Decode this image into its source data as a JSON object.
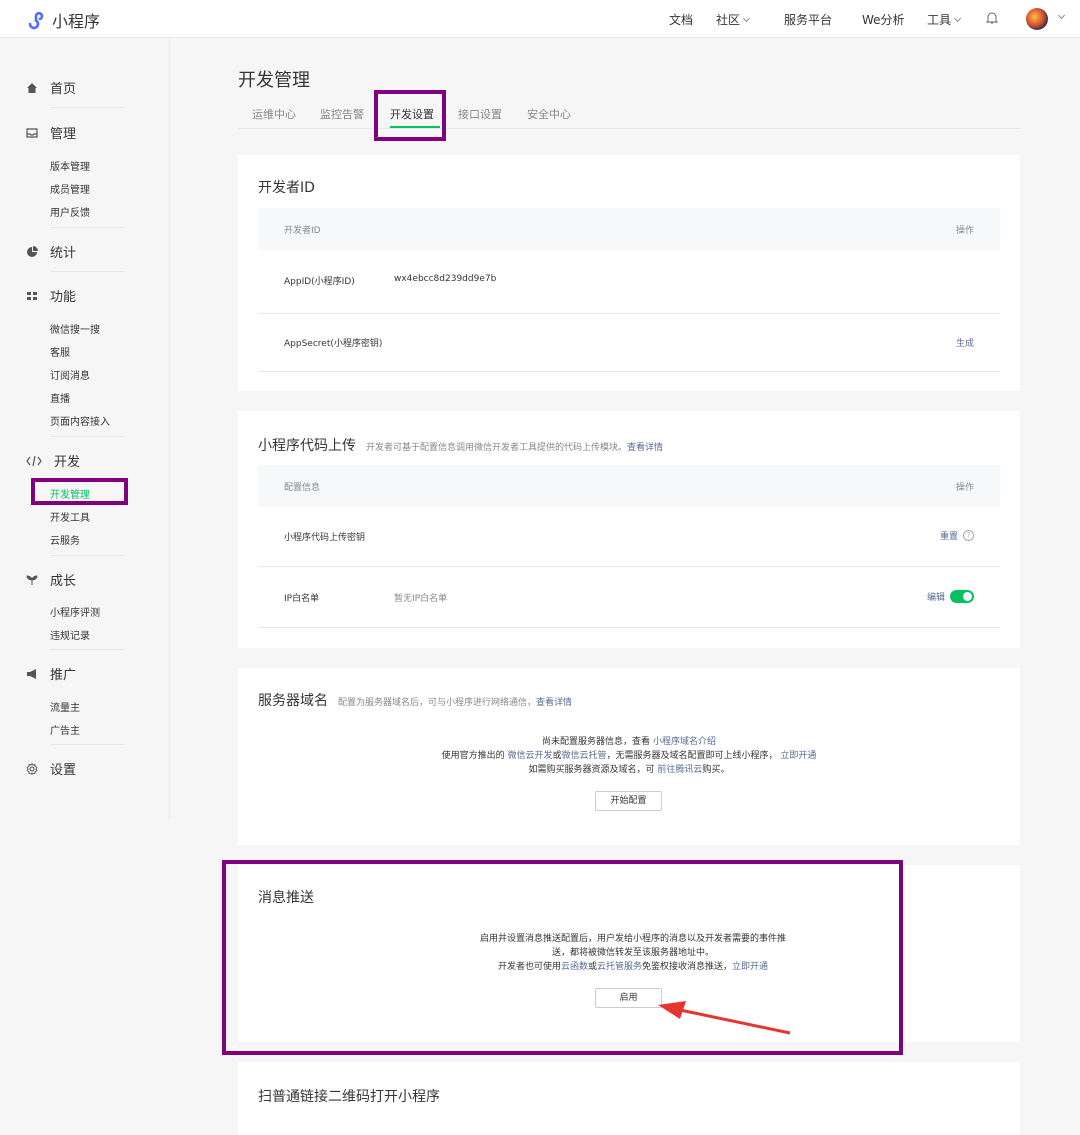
{
  "topbar": {
    "app_name": "小程序",
    "nav": [
      {
        "label": "文档",
        "dropdown": false
      },
      {
        "label": "社区",
        "dropdown": true
      },
      {
        "label": "服务平台",
        "dropdown": false
      },
      {
        "label": "We分析",
        "dropdown": false
      },
      {
        "label": "工具",
        "dropdown": true
      }
    ]
  },
  "sidebar": {
    "home": "首页",
    "manage": {
      "label": "管理",
      "items": [
        "版本管理",
        "成员管理",
        "用户反馈"
      ]
    },
    "stats": "统计",
    "features": {
      "label": "功能",
      "items": [
        "微信搜一搜",
        "客服",
        "订阅消息",
        "直播",
        "页面内容接入"
      ]
    },
    "dev": {
      "label": "开发",
      "items": [
        "开发管理",
        "开发工具",
        "云服务"
      ]
    },
    "growth": {
      "label": "成长",
      "items": [
        "小程序评测",
        "违规记录"
      ]
    },
    "promo": {
      "label": "推广",
      "items": [
        "流量主",
        "广告主"
      ]
    },
    "settings": "设置"
  },
  "main": {
    "title": "开发管理",
    "tabs": [
      "运维中心",
      "监控告警",
      "开发设置",
      "接口设置",
      "安全中心"
    ],
    "active_tab": "开发设置"
  },
  "dev_id": {
    "title": "开发者ID",
    "col_left": "开发者ID",
    "col_right": "操作",
    "appid_label": "AppID(小程序ID)",
    "appid_value": "wx4ebcc8d239dd9e7b",
    "secret_label": "AppSecret(小程序密钥)",
    "secret_action": "生成"
  },
  "upload": {
    "title": "小程序代码上传",
    "desc": "开发者可基于配置信息调用微信开发者工具提供的代码上传模块。",
    "desc_link": "查看详情",
    "col_left": "配置信息",
    "col_right": "操作",
    "key_label": "小程序代码上传密钥",
    "key_action": "重置",
    "key_help": "?",
    "ip_label": "IP白名单",
    "ip_value": "暂无IP白名单",
    "ip_action": "编辑"
  },
  "server": {
    "title": "服务器域名",
    "desc": "配置为服务器域名后，可与小程序进行网络通信，",
    "desc_link": "查看详情",
    "line1_a": "尚未配置服务器信息，查看",
    "line1_link": "小程序域名介绍",
    "line2_a": "使用官方推出的",
    "line2_link1": "微信云开发",
    "line2_b": "或",
    "line2_link2": "微信云托管",
    "line2_c": "，无需服务器及域名配置即可上线小程序，",
    "line2_link3": "立即开通",
    "line3_a": "如需购买服务器资源及域名，可",
    "line3_link": "前往腾讯云",
    "line3_b": "购买。",
    "button": "开始配置"
  },
  "push": {
    "title": "消息推送",
    "line1": "启用并设置消息推送配置后，用户发给小程序的消息以及开发者需要的事件推",
    "line2": "送，都将被微信转发至该服务器地址中。",
    "line3_a": "开发者也可使用",
    "line3_link1": "云函数",
    "line3_b": "或",
    "line3_link2": "云托管服务",
    "line3_c": "免鉴权接收消息推送，",
    "line3_link3": "立即开通",
    "button": "启用"
  },
  "qrcode": {
    "title": "扫普通链接二维码打开小程序"
  },
  "colors": {
    "accent": "#07c160",
    "link": "#576b95",
    "highlight": "#800080",
    "arrow": "#e8342e"
  }
}
